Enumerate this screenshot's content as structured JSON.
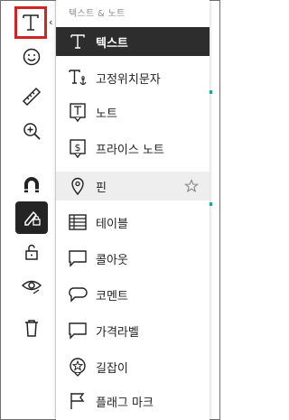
{
  "panel": {
    "header": "텍스트 & 노트",
    "items": [
      {
        "label": "텍스트",
        "icon": "text-icon"
      },
      {
        "label": "고정위치문자",
        "icon": "anchored-text-icon"
      },
      {
        "label": "노트",
        "icon": "note-icon"
      },
      {
        "label": "프라이스 노트",
        "icon": "price-note-icon"
      },
      {
        "label": "핀",
        "icon": "pin-icon"
      },
      {
        "label": "테이블",
        "icon": "table-icon"
      },
      {
        "label": "콜아웃",
        "icon": "callout-icon"
      },
      {
        "label": "코멘트",
        "icon": "comment-icon"
      },
      {
        "label": "가격라벨",
        "icon": "price-label-icon"
      },
      {
        "label": "길잡이",
        "icon": "guide-icon"
      },
      {
        "label": "플래그 마크",
        "icon": "flag-icon"
      }
    ]
  },
  "toolbar": {
    "tools": [
      "text-tool-icon",
      "emoji-icon",
      "ruler-icon",
      "zoom-in-icon",
      "magnet-icon",
      "pen-lock-icon",
      "unlock-icon",
      "eye-icon",
      "trash-icon"
    ],
    "selected": "text-tool-icon",
    "active": "pen-lock-icon"
  },
  "colors": {
    "selected_bg": "#2d2d2d",
    "highlight_border": "#d32323",
    "accent": "#1ba5a0"
  }
}
